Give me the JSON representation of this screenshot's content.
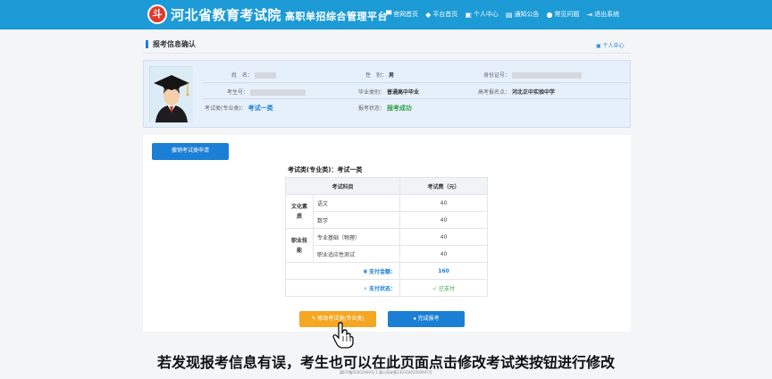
{
  "header": {
    "logo_text": "斗",
    "title": "河北省教育考试院",
    "subtitle": "高职单招综合管理平台",
    "nav": [
      {
        "icon": "home-icon",
        "glyph": "▀",
        "label": "官网首页"
      },
      {
        "icon": "platform-icon",
        "glyph": "◆",
        "label": "平台首页"
      },
      {
        "icon": "user-icon",
        "glyph": "▣",
        "label": "个人中心"
      },
      {
        "icon": "notice-icon",
        "glyph": "▤",
        "label": "通知公告"
      },
      {
        "icon": "faq-icon",
        "glyph": "●",
        "label": "常见问题"
      },
      {
        "icon": "logout-icon",
        "glyph": "⇥",
        "label": "退出系统"
      }
    ]
  },
  "page": {
    "title": "报考信息确认",
    "center_link": "个人中心"
  },
  "profile": {
    "name_label": "姓　名：",
    "gender_label": "性　别：",
    "gender_value": "男",
    "id_label": "身份证号：",
    "exam_no_label": "考生号：",
    "grad_type_label": "毕业类别：",
    "grad_type_value": "普通高中毕业",
    "site_label": "高考报名点：",
    "site_value": "河北正中实验中学",
    "exam_type_label": "考试类(专业类)：",
    "exam_type_value": "考试一类",
    "status_label": "报考状态：",
    "status_value": "报考成功"
  },
  "fees": {
    "cancel_button": "撤销考试类申请",
    "type_title": "考试类(专业类)：考试一类",
    "col_subject": "考试科目",
    "col_fee": "考试费（元）",
    "group1": "文化素质",
    "group2": "职业技能",
    "rows": [
      {
        "subject": "语文",
        "fee": "40"
      },
      {
        "subject": "数学",
        "fee": "40"
      },
      {
        "subject": "专业基础（物理）",
        "fee": "40"
      },
      {
        "subject": "职业适应性测试",
        "fee": "40"
      }
    ],
    "total_label": "¥ 支付金额：",
    "total_value": "160",
    "pay_status_label": "⚡ 支付状态：",
    "pay_status_value": "✓ 已支付"
  },
  "actions": {
    "modify_button": "✎ 修改考试类(专业类)",
    "finish_button": "● 完成报考"
  },
  "caption": "若发现报考信息有误，考生也可以在此页面点击修改考试类按钮进行修改",
  "footer": "冀ICP备05002906号-1    冀公网安备13010402000947号"
}
